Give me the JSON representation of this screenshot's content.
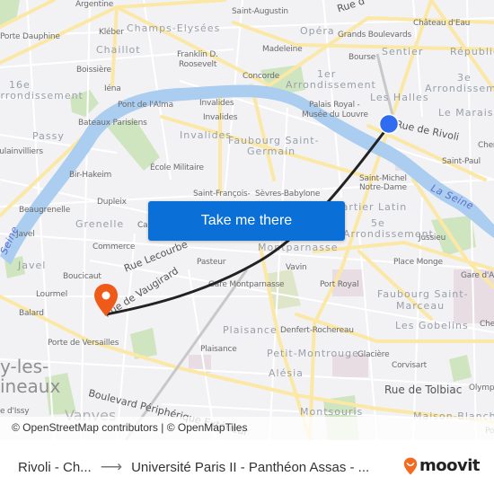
{
  "map": {
    "labels": {
      "argentine": "Argentine",
      "saint_augustin": "Saint-Augustin",
      "rue_top": "Rue d",
      "chateau_deau": "Château d'Eau",
      "porte_dauphine": "Porte Dauphine",
      "kleber": "Kléber",
      "champs_elysees": "Champs-Elysées",
      "opera": "Opéra",
      "grands_boulevards": "Grands Boulevards",
      "chaillot": "Chaillot",
      "madeleine": "Madeleine",
      "sentier": "Sentier",
      "republique": "République",
      "franklin": "Franklin D.",
      "roosevelt": "Roosevelt",
      "bourse": "Bourse",
      "boissiere": "Boissière",
      "arr16_a": "16e",
      "arr16_b": "Arrondissement",
      "concorde": "Concorde",
      "arr1_a": "1er",
      "arr1_b": "Arrondissement",
      "arr3_a": "3e",
      "arr3_b": "Arrondissement",
      "iena": "Iéna",
      "les_halles": "Les Halles",
      "palais_royal_a": "Palais Royal -",
      "palais_royal_b": "Musée du Louvre",
      "le_marais": "Le Marais",
      "pont_alma": "Pont de l'Alma",
      "invalides_1": "Invalides",
      "invalides_2": "Invalides",
      "bateaux": "Bateaux Parisiens",
      "rue_rivoli": "Rue de Rivoli",
      "passy": "Passy",
      "invalides_district": "Invalides",
      "faubourg_sg_a": "Faubourg Saint-",
      "faubourg_sg_b": "Germain",
      "chem": "Chem",
      "boulainvilliers": "Boulainvilliers",
      "saint_paul": "Saint-Paul",
      "ecole_militaire": "École Militaire",
      "bir_hakeim": "Bir-Hakeim",
      "saint_michel_a": "Saint-Michel",
      "saint_michel_b": "Notre-Dame",
      "la_seine_1": "La Seine",
      "dupleix": "Dupleix",
      "saint_francois": "Saint-François-",
      "sevres_babylone": "Sèvres-Babylone",
      "quartier_latin": "Quartier Latin",
      "beaugrenelle": "Beaugrenelle",
      "grenelle": "Grenelle",
      "cambronne": "Ca",
      "arr5_a": "5e",
      "arr5_b": "Arrondissement",
      "javel_station": "Javel",
      "la_seine_2": "Seine",
      "jussieu": "Jussieu",
      "commerce": "Commerce",
      "rue_lecourbe": "Rue Lecourbe",
      "montparnasse": "Montparnasse",
      "javel_district": "Javel",
      "pasteur": "Pasteur",
      "place_monge": "Place Monge",
      "boucicaut": "Boucicaut",
      "vavin": "Vavin",
      "gare_austerlitz": "Gare d'A",
      "rue_vaugirard": "Rue de Vaugirard",
      "gare_montparnasse": "Gare Montparnasse",
      "port_royal": "Port Royal",
      "lourmel": "Lourmel",
      "faubourg_sm_a": "Faubourg Saint-",
      "faubourg_sm_b": "Marceau",
      "balard": "Balard",
      "plaisance_district": "Plaisance",
      "denfert": "Denfert-Rochereau",
      "les_gobelins": "Les Gobelins",
      "che": "Che",
      "porte_versailles": "Porte de Versailles",
      "petit_montrouge": "Petit-Montrouge",
      "glaciere": "Glacière",
      "plaisance_station": "Plaisance",
      "corvisart": "Corvisart",
      "issy_a": "y-les-",
      "issy_b": "ineaux",
      "boulevard_peripherique": "Boulevard Périphérique Extérieur",
      "alesia": "Alésia",
      "rue_tolbiac": "Rue de Tolbiac",
      "olymp": "Olymp",
      "porte_issy": "e d'Issy",
      "vanves": "Vanves",
      "montsouris": "Montsouris",
      "maison_blanche": "Maison-Blanche",
      "po": "Po"
    },
    "origin_marker": {
      "icon": "origin-dot-icon",
      "color": "#2f6cf0"
    },
    "destination_marker": {
      "icon": "map-pin-icon",
      "color": "#f05a19"
    },
    "route_line_color": "#222222",
    "cta_button": {
      "label": "Take me there",
      "color": "#0a6fd6"
    },
    "attribution": "© OpenStreetMap contributors | © OpenMapTiles"
  },
  "footer": {
    "origin": "Rivoli - Ch...",
    "arrow_icon": "arrow-right-icon",
    "destination": "Université Paris II - Panthéon Assas - ...",
    "brand": {
      "name": "moovit",
      "color": "#f26b21",
      "icon": "moovit-pin-icon"
    }
  }
}
